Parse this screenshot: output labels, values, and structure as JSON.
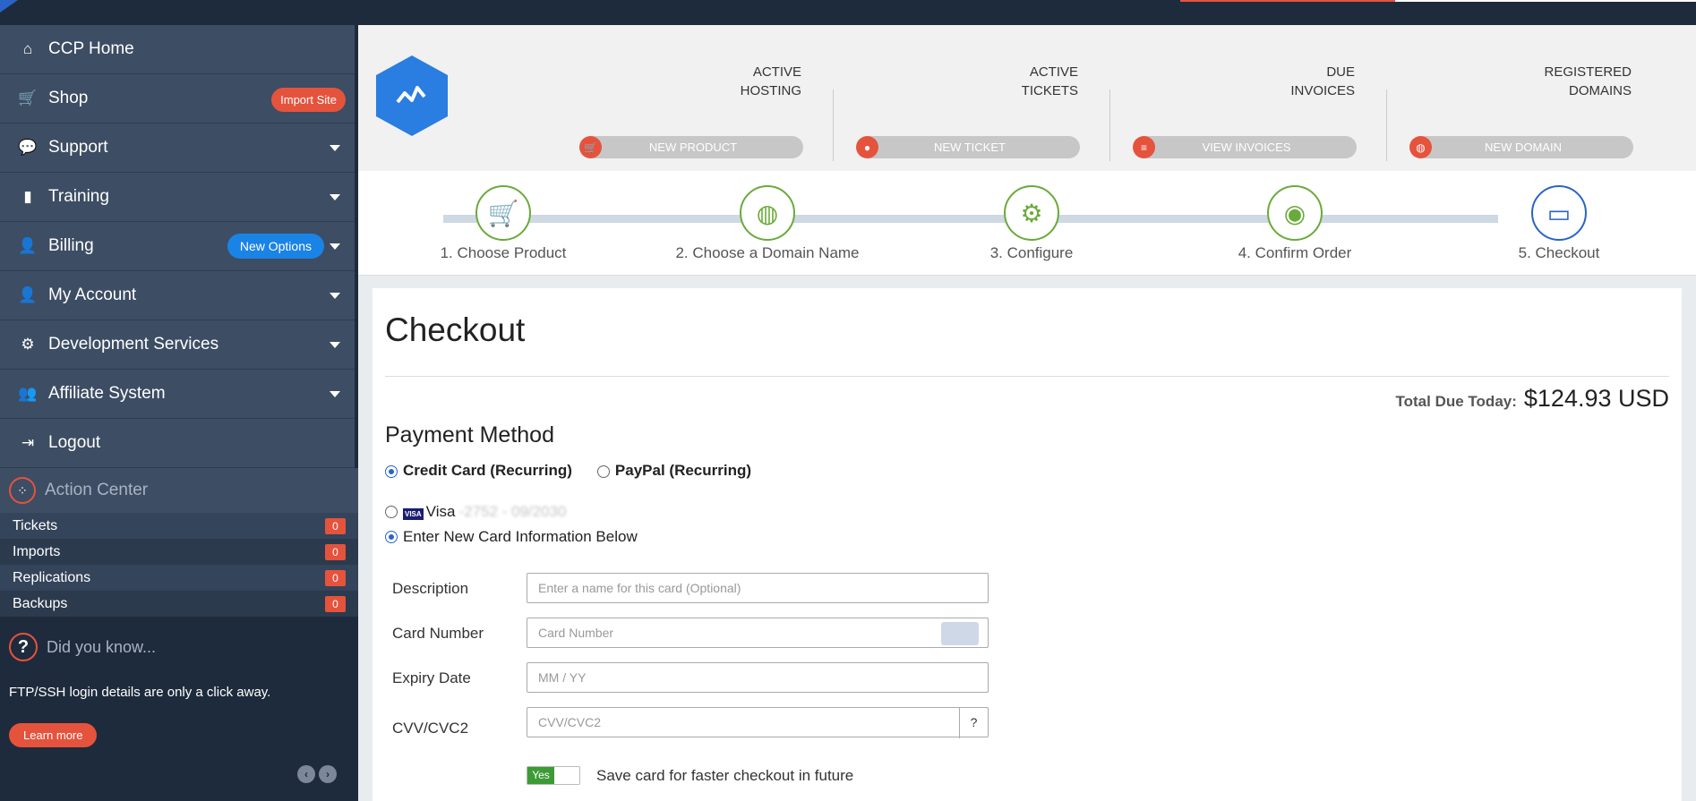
{
  "sidebar": {
    "items": [
      {
        "label": "CCP Home",
        "icon": "home-icon"
      },
      {
        "label": "Shop",
        "icon": "cart-icon",
        "badge": "Import Site"
      },
      {
        "label": "Support",
        "icon": "chat-icon"
      },
      {
        "label": "Training",
        "icon": "book-icon"
      },
      {
        "label": "Billing",
        "icon": "user-icon",
        "badge": "New Options"
      },
      {
        "label": "My Account",
        "icon": "user-icon"
      },
      {
        "label": "Development Services",
        "icon": "gears-icon"
      },
      {
        "label": "Affiliate System",
        "icon": "users-icon"
      },
      {
        "label": "Logout",
        "icon": "logout-icon"
      }
    ],
    "action_center": {
      "title": "Action Center",
      "rows": [
        {
          "label": "Tickets",
          "count": "0"
        },
        {
          "label": "Imports",
          "count": "0"
        },
        {
          "label": "Replications",
          "count": "0"
        },
        {
          "label": "Backups",
          "count": "0"
        }
      ]
    },
    "did_you_know": {
      "title": "Did you know...",
      "text": "FTP/SSH login details are only a click away.",
      "button": "Learn more"
    }
  },
  "stats": [
    {
      "line1": "ACTIVE",
      "line2": "HOSTING",
      "button": "NEW PRODUCT"
    },
    {
      "line1": "ACTIVE",
      "line2": "TICKETS",
      "button": "NEW TICKET"
    },
    {
      "line1": "DUE",
      "line2": "INVOICES",
      "button": "VIEW INVOICES"
    },
    {
      "line1": "REGISTERED",
      "line2": "DOMAINS",
      "button": "NEW DOMAIN"
    }
  ],
  "steps": [
    {
      "label": "1. Choose Product"
    },
    {
      "label": "2. Choose a Domain Name"
    },
    {
      "label": "3. Configure"
    },
    {
      "label": "4. Confirm Order"
    },
    {
      "label": "5. Checkout"
    }
  ],
  "checkout": {
    "title": "Checkout",
    "total_label": "Total Due Today:",
    "total_value": "$124.93 USD",
    "payment_title": "Payment Method",
    "methods": [
      "Credit Card (Recurring)",
      "PayPal (Recurring)"
    ],
    "saved_card": "Visa",
    "saved_card_masked": "-2752 - 09/2030",
    "new_card": "Enter New Card Information Below",
    "fields": {
      "description": {
        "label": "Description",
        "placeholder": "Enter a name for this card (Optional)"
      },
      "card_number": {
        "label": "Card Number",
        "placeholder": "Card Number"
      },
      "expiry": {
        "label": "Expiry Date",
        "placeholder": "MM / YY"
      },
      "cvv": {
        "label": "CVV/CVC2",
        "placeholder": "CVV/CVC2",
        "help": "?"
      }
    },
    "save_toggle": "Yes",
    "save_label": "Save card for faster checkout in future"
  },
  "colors": {
    "accent_red": "#e5533d",
    "accent_blue": "#2a64c8",
    "step_green": "#6aaa3a",
    "sidebar_bg": "#3d4d64"
  }
}
